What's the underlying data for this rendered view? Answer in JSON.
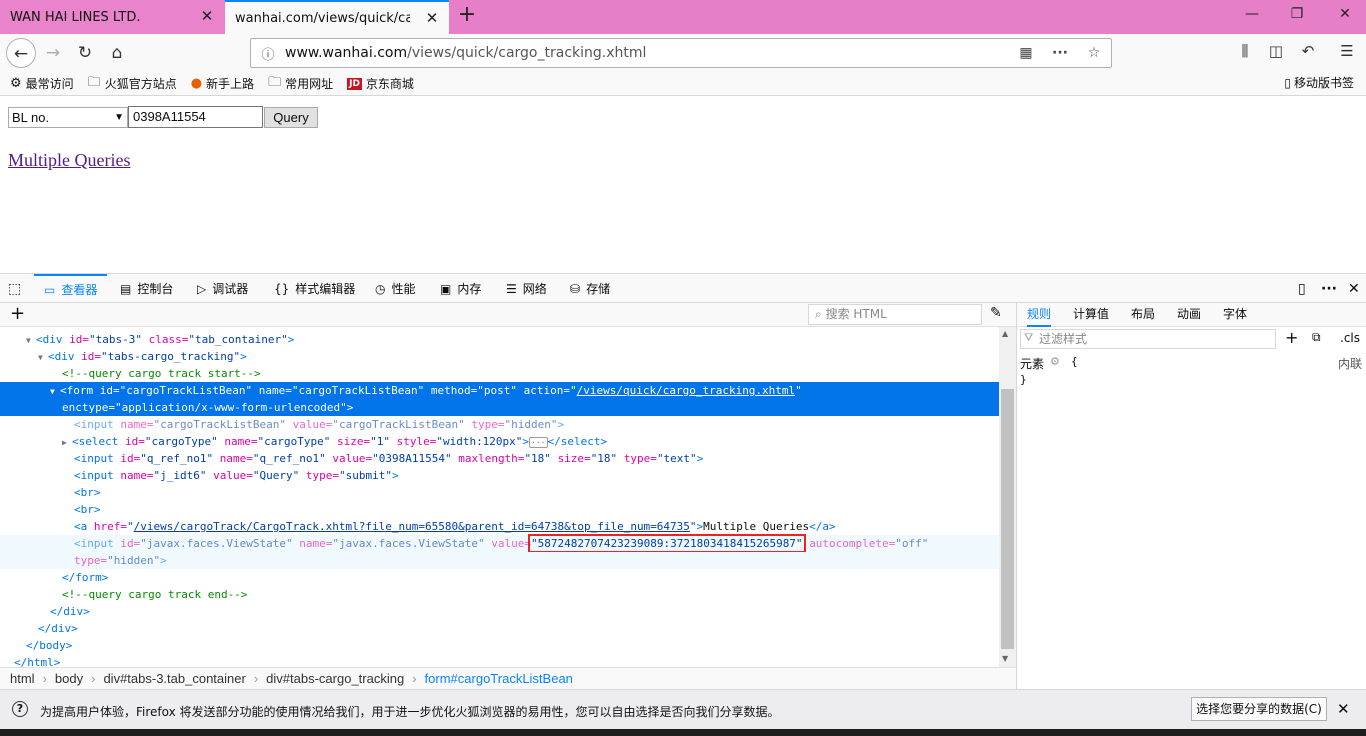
{
  "tabs": [
    {
      "title": "WAN HAI LINES LTD."
    },
    {
      "title": "wanhai.com/views/quick/cargo_"
    }
  ],
  "window_controls": {
    "minimize": "—",
    "restore": "❐",
    "close": "✕"
  },
  "address": {
    "domain": "www.wanhai.com",
    "path": "/views/quick/cargo_tracking.xhtml"
  },
  "bookmarks": [
    {
      "icon": "gear-icon",
      "glyph": "⚙",
      "label": "最常访问"
    },
    {
      "icon": "folder-icon",
      "glyph": "🗀",
      "label": "火狐官方站点"
    },
    {
      "icon": "firefox-icon",
      "glyph": "●",
      "label": "新手上路"
    },
    {
      "icon": "folder-icon",
      "glyph": "🗀",
      "label": "常用网址"
    },
    {
      "icon": "jd-icon",
      "glyph": "JD",
      "label": "京东商城"
    }
  ],
  "mobile_bookmarks": "移动版书签",
  "page": {
    "select_value": "BL no.",
    "input_value": "0398A11554",
    "query_label": "Query",
    "multiple_link": "Multiple Queries"
  },
  "devtools": {
    "tabs": [
      "查看器",
      "控制台",
      "调试器",
      "样式编辑器",
      "性能",
      "内存",
      "网络",
      "存储"
    ],
    "search_placeholder": "搜索 HTML",
    "markup": {
      "l1_tag": "<div",
      "l1_a1": "id=",
      "l1_v1": "\"tabs-3\"",
      "l1_a2": "class=",
      "l1_v2": "\"tab_container\"",
      "l2_tag": "<div",
      "l2_a1": "id=",
      "l2_v1": "\"tabs-cargo_tracking\"",
      "comment_start": "<!--query cargo track start-->",
      "form_tag": "<form",
      "form_id": "\"cargoTrackListBean\"",
      "form_name": "\"cargoTrackListBean\"",
      "form_method": "\"post\"",
      "form_action": "/views/quick/cargo_tracking.xhtml",
      "form_enctype": "\"application/x-www-form-urlencoded\"",
      "inp1_name": "\"cargoTrackListBean\"",
      "inp1_value": "\"cargoTrackListBean\"",
      "inp1_type": "\"hidden\"",
      "sel_id": "\"cargoType\"",
      "sel_name": "\"cargoType\"",
      "sel_size": "\"1\"",
      "sel_style": "\"width:120px\"",
      "inp2_id": "\"q_ref_no1\"",
      "inp2_name": "\"q_ref_no1\"",
      "inp2_value": "\"0398A11554\"",
      "inp2_max": "\"18\"",
      "inp2_size": "\"18\"",
      "inp2_type": "\"text\"",
      "inp3_name": "\"j_idt6\"",
      "inp3_value": "\"Query\"",
      "inp3_type": "\"submit\"",
      "a_href": "/views/cargoTrack/CargoTrack.xhtml?file_num=65580&parent_id=64738&top_file_num=64735",
      "a_text": "Multiple Queries",
      "vs_id": "\"javax.faces.ViewState\"",
      "vs_name": "\"javax.faces.ViewState\"",
      "vs_value": "\"5872482707423239089:3721803418415265987\"",
      "vs_auto": "\"off\"",
      "vs_type": "\"hidden\"",
      "comment_end": "<!--query cargo track end-->"
    },
    "breadcrumbs": [
      "html",
      "body",
      "div#tabs-3.tab_container",
      "div#tabs-cargo_tracking",
      "form#cargoTrackListBean"
    ],
    "rules_tabs": [
      "规则",
      "计算值",
      "布局",
      "动画",
      "字体"
    ],
    "filter_placeholder": "过滤样式",
    "cls_label": ".cls",
    "element_label": "元素",
    "inline_label": "内联"
  },
  "notification": {
    "text": "为提高用户体验，Firefox 将发送部分功能的使用情况给我们，用于进一步优化火狐浏览器的易用性，您可以自由选择是否向我们分享数据。",
    "button": "选择您要分享的数据(C)"
  }
}
